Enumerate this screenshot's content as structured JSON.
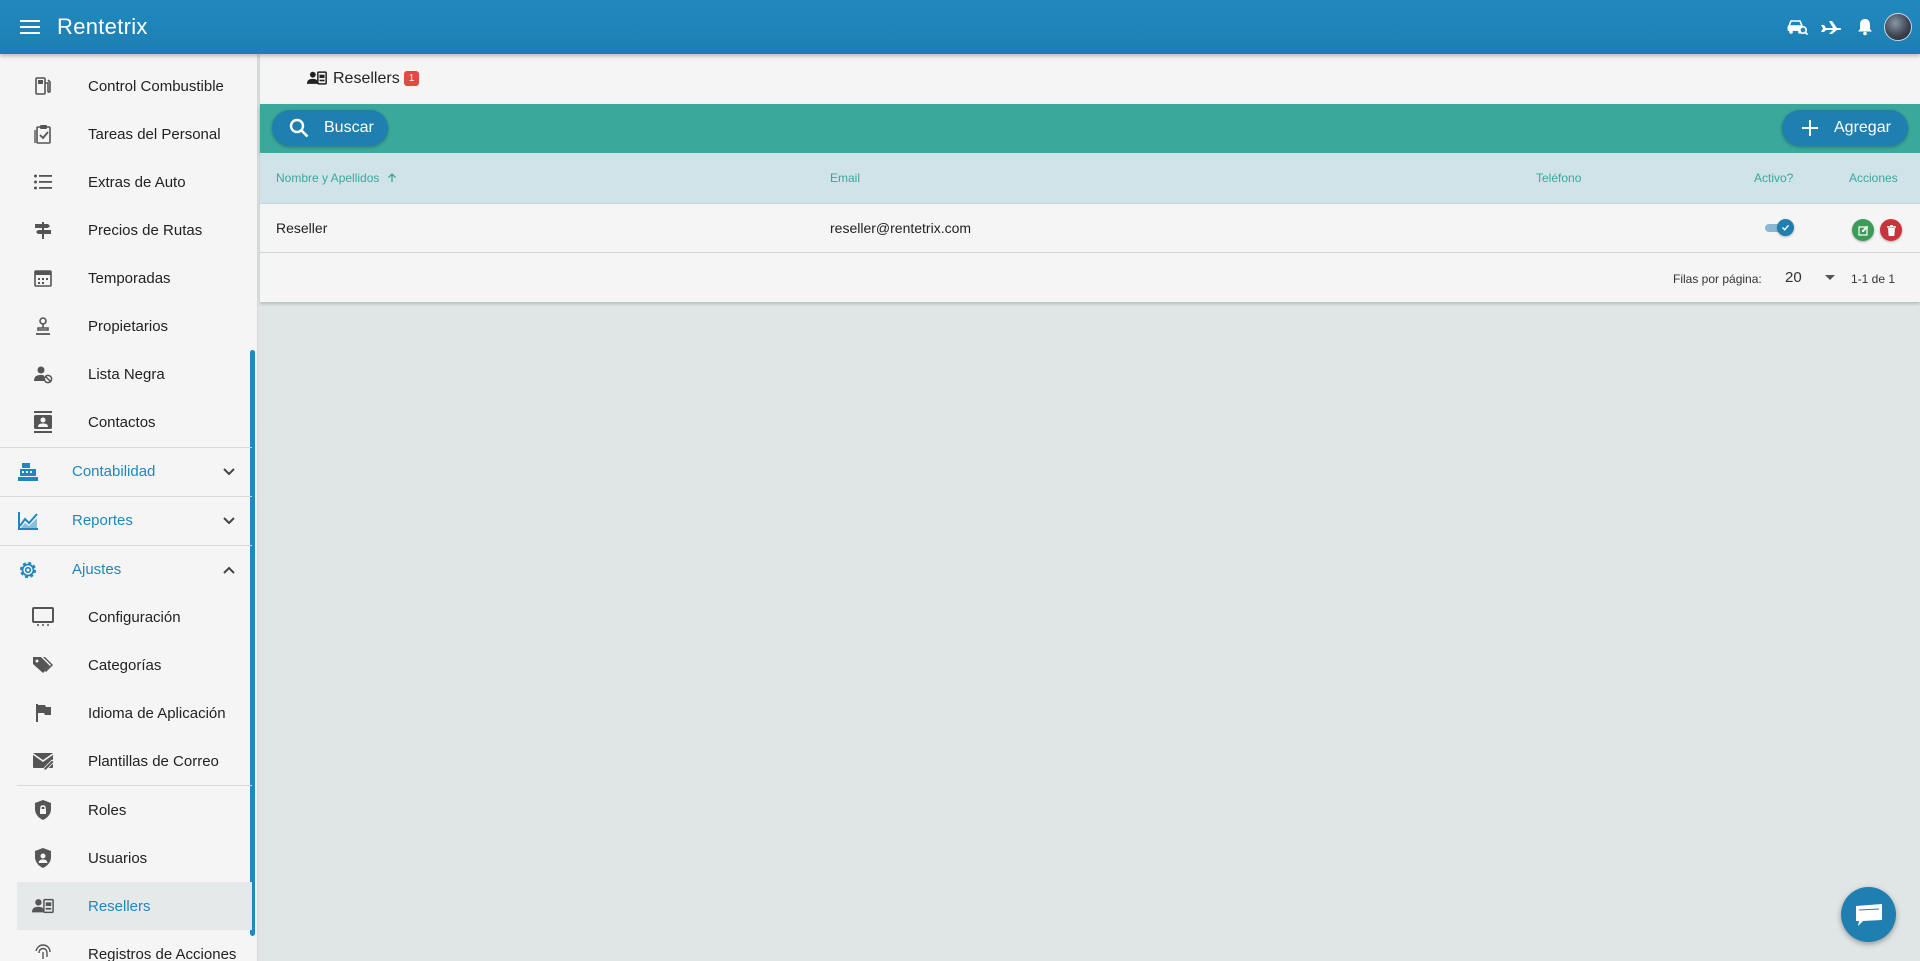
{
  "app": {
    "title": "Rentetrix"
  },
  "topbar": {
    "icons": [
      "car-search-icon",
      "plane-icon",
      "bell-icon",
      "avatar"
    ]
  },
  "sidebar": {
    "items": [
      {
        "label": "Control Combustible",
        "icon": "fuel-icon"
      },
      {
        "label": "Tareas del Personal",
        "icon": "clipboard-check-icon"
      },
      {
        "label": "Extras de Auto",
        "icon": "list-icon"
      },
      {
        "label": "Precios de Rutas",
        "icon": "signpost-icon"
      },
      {
        "label": "Temporadas",
        "icon": "calendar-icon"
      },
      {
        "label": "Propietarios",
        "icon": "owner-icon"
      },
      {
        "label": "Lista Negra",
        "icon": "user-block-icon"
      },
      {
        "label": "Contactos",
        "icon": "contacts-icon"
      }
    ],
    "groups": [
      {
        "label": "Contabilidad",
        "icon": "cash-register-icon",
        "expanded": false
      },
      {
        "label": "Reportes",
        "icon": "chart-line-icon",
        "expanded": false
      },
      {
        "label": "Ajustes",
        "icon": "gear-icon",
        "expanded": true
      }
    ],
    "settings_items": [
      {
        "label": "Configuración",
        "icon": "monitor-icon"
      },
      {
        "label": "Categorías",
        "icon": "tags-icon"
      },
      {
        "label": "Idioma de Aplicación",
        "icon": "flag-icon"
      },
      {
        "label": "Plantillas de Correo",
        "icon": "mail-template-icon"
      },
      {
        "label": "Roles",
        "icon": "shield-lock-icon"
      },
      {
        "label": "Usuarios",
        "icon": "shield-user-icon"
      },
      {
        "label": "Resellers",
        "icon": "reseller-icon",
        "active": true
      },
      {
        "label": "Registros de Acciones",
        "icon": "fingerprint-icon"
      }
    ]
  },
  "page": {
    "title": "Resellers",
    "count": "1",
    "search_label": "Buscar",
    "add_label": "Agregar"
  },
  "table": {
    "columns": {
      "name": "Nombre y Apellidos",
      "email": "Email",
      "phone": "Teléfono",
      "active": "Activo?",
      "actions": "Acciones"
    },
    "rows": [
      {
        "name": "Reseller",
        "email": "reseller@rentetrix.com",
        "phone": "",
        "active": true
      }
    ],
    "footer": {
      "rows_per_page_label": "Filas por página:",
      "rows_per_page": "20",
      "range": "1-1 de 1"
    }
  },
  "colors": {
    "primary": "#1f87bd",
    "toolbar": "#3aa89b",
    "badge": "#e2493f",
    "edit": "#3b9b58",
    "delete": "#c8343b"
  }
}
